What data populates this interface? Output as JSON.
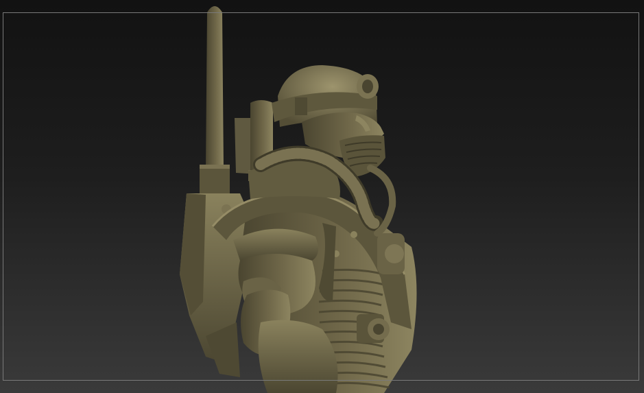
{
  "viewport": {
    "background_top": "#121212",
    "background_bottom": "#3a3a3a",
    "frame_color": "#7a7a7a"
  },
  "model": {
    "subject": "diver-figure-sculpt",
    "material_color": "#6e6648",
    "shadow_color": "#3e3a28",
    "highlight_color": "#a39a74"
  }
}
